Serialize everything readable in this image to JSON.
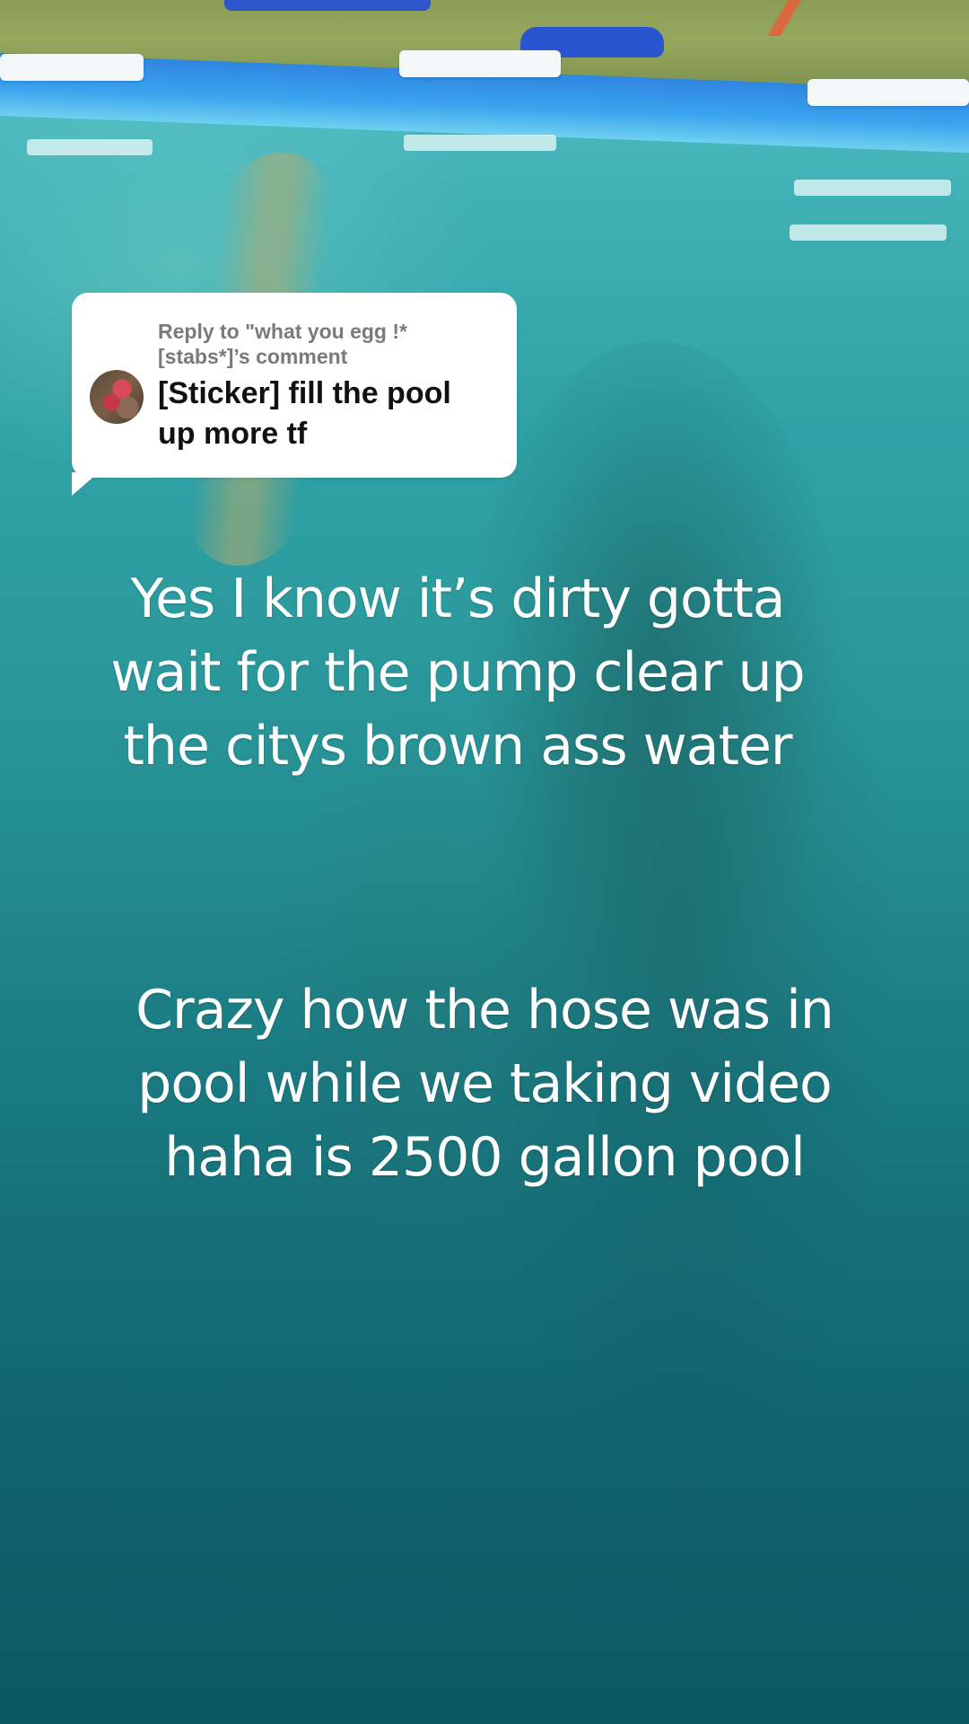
{
  "reply": {
    "header_line1": "Reply to \"what you egg !*",
    "header_line2": "[stabs*]’s comment",
    "comment_line1": "[Sticker] fill the pool",
    "comment_line2": "up more tf"
  },
  "captions": [
    {
      "lines": [
        "Yes I know it’s dirty gotta",
        "wait for the pump clear up",
        "the citys brown ass water"
      ]
    },
    {
      "lines": [
        "Crazy how the hose was in",
        "pool while we taking video",
        "haha is 2500 gallon pool"
      ]
    }
  ],
  "colors": {
    "water_top": "#56c3c9",
    "water_bottom": "#0c5862",
    "pool_rim": "#2f86e0",
    "bubble_bg": "#ffffff",
    "bubble_header_text": "#7a7a7a",
    "comment_text": "#111111",
    "caption_text": "#ffffff"
  },
  "icons": {
    "commenter_avatar": "avatar"
  }
}
